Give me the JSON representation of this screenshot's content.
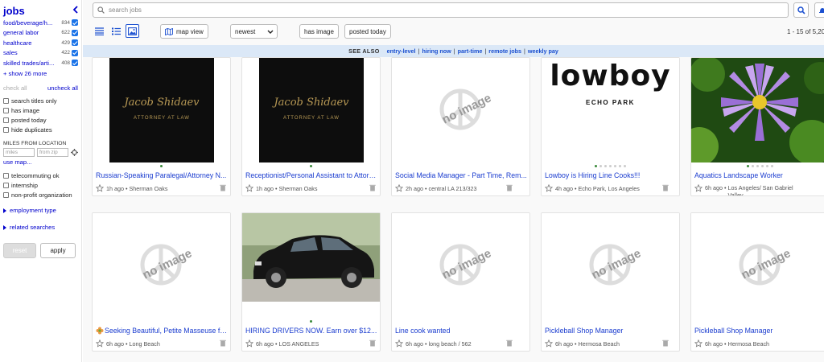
{
  "sidebar": {
    "title": "jobs",
    "categories": [
      {
        "name": "food/beverage/h...",
        "count": "834"
      },
      {
        "name": "general labor",
        "count": "622"
      },
      {
        "name": "healthcare",
        "count": "429"
      },
      {
        "name": "sales",
        "count": "422"
      },
      {
        "name": "skilled trades/arti...",
        "count": "408"
      }
    ],
    "show_more": "+ show 26 more",
    "check_all": "check all",
    "uncheck_all": "uncheck all",
    "options": [
      "search titles only",
      "has image",
      "posted today",
      "hide duplicates"
    ],
    "miles_label": "MILES FROM LOCATION",
    "miles_placeholder": "miles",
    "zip_placeholder": "from zip",
    "use_map": "use map...",
    "options2": [
      "telecommuting ok",
      "internship",
      "non-profit organization"
    ],
    "employment_type": "employment type",
    "related_searches": "related searches",
    "reset": "reset",
    "apply": "apply"
  },
  "toolbar": {
    "search_placeholder": "search jobs",
    "map_view": "map view",
    "sort": "newest",
    "has_image": "has image",
    "posted_today": "posted today",
    "pager": "1 - 15 of 5,20"
  },
  "see_also": {
    "label": "SEE ALSO",
    "links": [
      "entry-level",
      "hiring now",
      "part-time",
      "remote jobs",
      "weekly pay"
    ]
  },
  "no_image_text": "no image",
  "logo_texts": {
    "attorney_name": "Jacob Shidaev",
    "attorney_sub": "ATTORNEY AT LAW",
    "lowboy": "lowboy",
    "echo_park": "ECHO PARK"
  },
  "listings": [
    {
      "title": "Russian-Speaking Paralegal/Attorney N...",
      "time": "1h ago",
      "location": "Sherman Oaks"
    },
    {
      "title": "Receptionist/Personal Assistant to Attorn...",
      "time": "1h ago",
      "location": "Sherman Oaks"
    },
    {
      "title": "Social Media Manager - Part Time, Rem...",
      "time": "2h ago",
      "location": "central LA 213/323"
    },
    {
      "title": "Lowboy is Hiring Line Cooks!!!",
      "time": "4h ago",
      "location": "Echo Park, Los Angeles"
    },
    {
      "title": "Aquatics Landscape Worker",
      "time": "6h ago",
      "location": "Los Angeles/ San Gabriel Valley"
    },
    {
      "title": "Seeking Beautiful, Petite Masseuse fo...",
      "time": "6h ago",
      "location": "Long Beach"
    },
    {
      "title": "HIRING DRIVERS NOW. Earn over $12...",
      "time": "6h ago",
      "location": "LOS ANGELES"
    },
    {
      "title": "Line cook wanted",
      "time": "6h ago",
      "location": "long beach / 562"
    },
    {
      "title": "Pickleball Shop Manager",
      "time": "6h ago",
      "location": "Hermosa Beach"
    },
    {
      "title": "Pickleball Shop Manager",
      "time": "6h ago",
      "location": "Hermosa Beach"
    }
  ]
}
